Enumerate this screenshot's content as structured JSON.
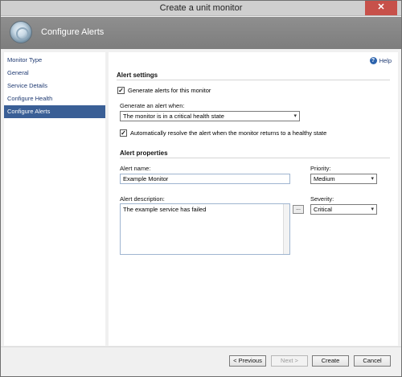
{
  "window": {
    "title": "Create a unit monitor",
    "close_glyph": "✕"
  },
  "banner": {
    "title": "Configure Alerts",
    "icon": "monitor-ring-icon"
  },
  "nav": {
    "items": [
      {
        "label": "Monitor Type",
        "active": false
      },
      {
        "label": "General",
        "active": false
      },
      {
        "label": "Service Details",
        "active": false
      },
      {
        "label": "Configure Health",
        "active": false
      },
      {
        "label": "Configure Alerts",
        "active": true
      }
    ]
  },
  "help": {
    "label": "Help",
    "glyph": "?"
  },
  "alert_settings": {
    "title": "Alert settings",
    "generate_checkbox": {
      "label": "Generate alerts for this monitor",
      "checked": true,
      "glyph": "✓"
    },
    "generate_when_label": "Generate an alert when:",
    "generate_when_value": "The monitor is in a critical health state",
    "auto_resolve_checkbox": {
      "label": "Automatically resolve the alert when the monitor returns to a healthy state",
      "checked": true,
      "glyph": "✓"
    }
  },
  "alert_properties": {
    "title": "Alert properties",
    "name_label": "Alert name:",
    "name_value": "Example Monitor",
    "priority_label": "Priority:",
    "priority_value": "Medium",
    "description_label": "Alert description:",
    "description_value": "The example service has failed",
    "ellipsis_label": "...",
    "severity_label": "Severity:",
    "severity_value": "Critical",
    "chevron": "▾"
  },
  "footer": {
    "previous": "< Previous",
    "next": "Next >",
    "create": "Create",
    "cancel": "Cancel"
  }
}
